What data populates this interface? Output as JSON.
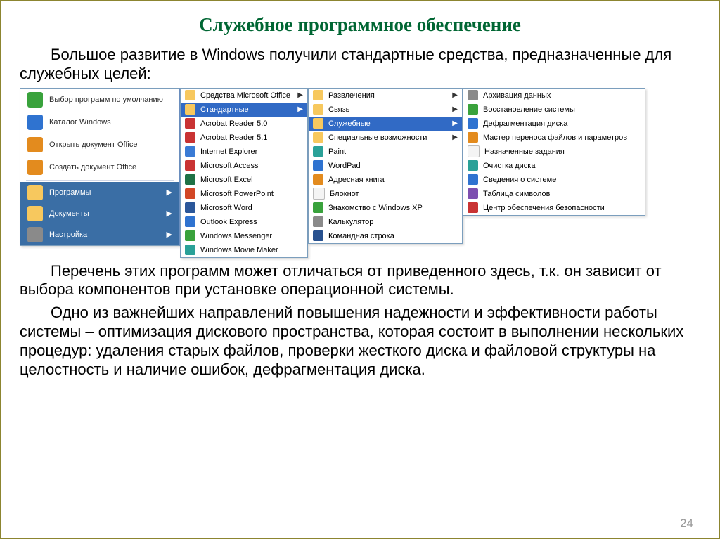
{
  "title": "Служебное программное обеспечение",
  "intro": "Большое развитие в Windows получили стандартные средства, предназначенные для служебных целей:",
  "para2": "Перечень этих программ может отличаться от приведенного здесь, т.к. он зависит от выбора компонентов при установке операционной системы.",
  "para3": "Одно из важнейших направлений повышения надежности и эффективности работы системы – оптимизация дискового пространства, которая состоит в выполнении нескольких процедур: удаления старых файлов, проверки жесткого диска и файловой структуры на целостность и наличие ошибок, дефрагментация диска.",
  "page_number": "24",
  "start_items": [
    {
      "label": "Выбор программ по умолчанию",
      "icon": "c-green"
    },
    {
      "label": "Каталог Windows",
      "icon": "c-blue"
    },
    {
      "label": "Открыть документ Office",
      "icon": "c-orange"
    },
    {
      "label": "Создать документ Office",
      "icon": "c-orange"
    }
  ],
  "start_band": [
    {
      "label": "Программы",
      "icon": "c-folder",
      "arrow": true
    },
    {
      "label": "Документы",
      "icon": "c-folder",
      "arrow": true
    },
    {
      "label": "Настройка",
      "icon": "c-grey",
      "arrow": true
    }
  ],
  "programs_menu": [
    {
      "label": "Средства Microsoft Office",
      "icon": "c-folder",
      "arrow": true
    },
    {
      "label": "Стандартные",
      "icon": "c-folder",
      "arrow": true,
      "selected": true
    },
    {
      "label": "Acrobat Reader 5.0",
      "icon": "c-red"
    },
    {
      "label": "Acrobat Reader 5.1",
      "icon": "c-red"
    },
    {
      "label": "Internet Explorer",
      "icon": "c-ie"
    },
    {
      "label": "Microsoft Access",
      "icon": "c-red"
    },
    {
      "label": "Microsoft Excel",
      "icon": "c-xl"
    },
    {
      "label": "Microsoft PowerPoint",
      "icon": "c-pp"
    },
    {
      "label": "Microsoft Word",
      "icon": "c-wd"
    },
    {
      "label": "Outlook Express",
      "icon": "c-blue"
    },
    {
      "label": "Windows Messenger",
      "icon": "c-green"
    },
    {
      "label": "Windows Movie Maker",
      "icon": "c-teal"
    }
  ],
  "standard_menu": [
    {
      "label": "Развлечения",
      "icon": "c-folder",
      "arrow": true
    },
    {
      "label": "Связь",
      "icon": "c-folder",
      "arrow": true
    },
    {
      "label": "Служебные",
      "icon": "c-folder",
      "arrow": true,
      "selected": true
    },
    {
      "label": "Специальные возможности",
      "icon": "c-folder",
      "arrow": true
    },
    {
      "label": "Paint",
      "icon": "c-teal"
    },
    {
      "label": "WordPad",
      "icon": "c-blue"
    },
    {
      "label": "Адресная книга",
      "icon": "c-orange"
    },
    {
      "label": "Блокнот",
      "icon": "c-white"
    },
    {
      "label": "Знакомство с Windows XP",
      "icon": "c-green"
    },
    {
      "label": "Калькулятор",
      "icon": "c-grey"
    },
    {
      "label": "Командная строка",
      "icon": "c-navy"
    }
  ],
  "system_tools_menu": [
    {
      "label": "Архивация данных",
      "icon": "c-grey"
    },
    {
      "label": "Восстановление системы",
      "icon": "c-green"
    },
    {
      "label": "Дефрагментация диска",
      "icon": "c-blue"
    },
    {
      "label": "Мастер переноса файлов и параметров",
      "icon": "c-orange"
    },
    {
      "label": "Назначенные задания",
      "icon": "c-white"
    },
    {
      "label": "Очистка диска",
      "icon": "c-teal"
    },
    {
      "label": "Сведения о системе",
      "icon": "c-blue"
    },
    {
      "label": "Таблица символов",
      "icon": "c-purple"
    },
    {
      "label": "Центр обеспечения безопасности",
      "icon": "c-red"
    }
  ]
}
